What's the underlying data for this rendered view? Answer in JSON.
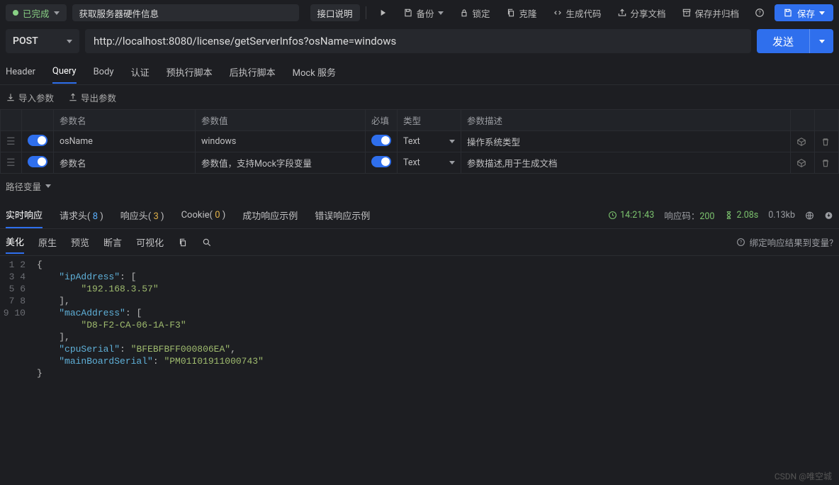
{
  "top": {
    "status_label": "已完成",
    "name": "获取服务器硬件信息",
    "api_desc": "接口说明",
    "backup": "备份",
    "lock": "锁定",
    "clone": "克隆",
    "gen_code": "生成代码",
    "share": "分享文档",
    "save_archive": "保存并归档",
    "save": "保存"
  },
  "request": {
    "method": "POST",
    "url": "http://localhost:8080/license/getServerInfos?osName=windows",
    "send": "发送"
  },
  "req_tabs": {
    "header": "Header",
    "query": "Query",
    "body": "Body",
    "auth": "认证",
    "pre": "预执行脚本",
    "post": "后执行脚本",
    "mock": "Mock 服务"
  },
  "import_export": {
    "import": "导入参数",
    "export": "导出参数"
  },
  "param_headers": {
    "name": "参数名",
    "value": "参数值",
    "required": "必填",
    "type": "类型",
    "desc": "参数描述"
  },
  "params": [
    {
      "name": "osName",
      "value": "windows",
      "type": "Text",
      "desc": "操作系统类型"
    }
  ],
  "param_placeholders": {
    "name": "参数名",
    "value": "参数值，支持Mock字段变量",
    "desc": "参数描述,用于生成文档"
  },
  "path_vars_label": "路径变量",
  "resp_tabs": {
    "realtime": "实时响应",
    "req_header": "请求头",
    "req_header_count": "8",
    "resp_header": "响应头",
    "resp_header_count": "3",
    "cookie": "Cookie",
    "cookie_count": "0",
    "success": "成功响应示例",
    "error": "错误响应示例"
  },
  "resp_meta": {
    "time": "14:21:43",
    "status_label": "响应码：",
    "status_code": "200",
    "elapsed": "2.08s",
    "size": "0.13kb"
  },
  "body_tabs": {
    "pretty": "美化",
    "raw": "原生",
    "preview": "预览",
    "assert": "断言",
    "visualize": "可视化",
    "bind_var": "绑定响应结果到变量?"
  },
  "response_json": {
    "ipAddress": [
      "192.168.3.57"
    ],
    "macAddress": [
      "D8-F2-CA-06-1A-F3"
    ],
    "cpuSerial": "BFEBFBFF000806EA",
    "mainBoardSerial": "PM01I01911000743"
  },
  "watermark": "CSDN @唯空城"
}
